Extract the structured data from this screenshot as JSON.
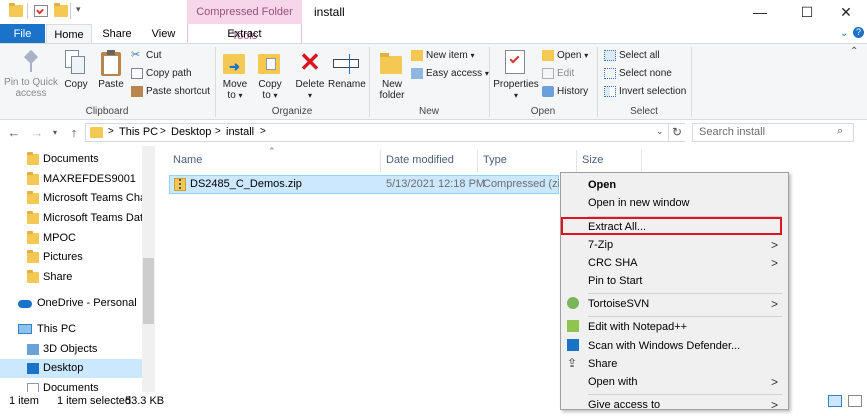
{
  "window": {
    "title": "install",
    "context_tab_header": "Compressed Folder Tools",
    "controls": {
      "minimize": "—",
      "maximize": "☐",
      "close": "✕"
    }
  },
  "tabs": {
    "file": "File",
    "home": "Home",
    "share": "Share",
    "view": "View",
    "extract": "Extract"
  },
  "ribbon": {
    "clipboard": {
      "pin": "Pin to Quick access",
      "copy": "Copy",
      "paste": "Paste",
      "cut": "Cut",
      "copy_path": "Copy path",
      "paste_shortcut": "Paste shortcut",
      "label": "Clipboard"
    },
    "organize": {
      "move_to": "Move to",
      "copy_to": "Copy to",
      "delete": "Delete",
      "rename": "Rename",
      "label": "Organize"
    },
    "new": {
      "new_folder": "New folder",
      "new_item": "New item",
      "easy_access": "Easy access",
      "label": "New"
    },
    "open": {
      "properties": "Properties",
      "open": "Open",
      "edit": "Edit",
      "history": "History",
      "label": "Open"
    },
    "select": {
      "select_all": "Select all",
      "select_none": "Select none",
      "invert": "Invert selection",
      "label": "Select"
    }
  },
  "address": {
    "this_pc": "This PC",
    "desktop": "Desktop",
    "install": "install",
    "sep": ">",
    "search_placeholder": "Search install"
  },
  "nav": {
    "items": [
      "Documents",
      "MAXREFDES9001",
      "Microsoft Teams Chat",
      "Microsoft Teams Data",
      "MPOC",
      "Pictures",
      "Share"
    ],
    "onedrive": "OneDrive - Personal",
    "this_pc": "This PC",
    "pc_items": [
      "3D Objects",
      "Desktop",
      "Documents"
    ]
  },
  "columns": {
    "name": "Name",
    "date": "Date modified",
    "type": "Type",
    "size": "Size"
  },
  "file": {
    "name": "DS2485_C_Demos.zip",
    "date": "5/13/2021 12:18 PM",
    "type": "Compressed (zipp"
  },
  "status": {
    "count": "1 item",
    "selected": "1 item selected",
    "size": "53.3 KB"
  },
  "menu": {
    "open": "Open",
    "open_new_window": "Open in new window",
    "extract_all": "Extract All...",
    "seven_zip": "7-Zip",
    "crc_sha": "CRC SHA",
    "pin_to_start": "Pin to Start",
    "tortoise": "TortoiseSVN",
    "notepad": "Edit with Notepad++",
    "defender": "Scan with Windows Defender...",
    "share": "Share",
    "open_with": "Open with",
    "give_access": "Give access to",
    "arrow": ">"
  },
  "colors": {
    "file_tab": "#1a73c8",
    "context_tab": "#f6d6e8",
    "selection": "#cce8ff",
    "highlight": "#e0141e"
  }
}
